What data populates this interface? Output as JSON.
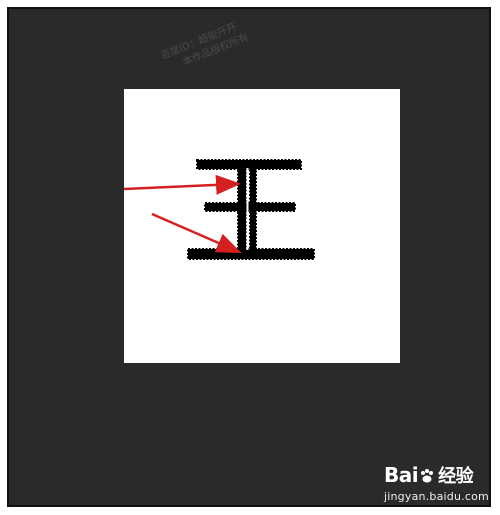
{
  "watermark": {
    "line1": "百度ID：超能开开",
    "line2": "本作品版权所有"
  },
  "canvas": {
    "glyph": "王",
    "selection": "marching-ants-outline",
    "annotations": [
      "red-arrow",
      "red-arrow"
    ]
  },
  "logo": {
    "brand": "Bai",
    "brand_suffix": "经验",
    "paw_icon": "baidu-paw-icon",
    "url": "jingyan.baidu.com"
  },
  "colors": {
    "frame": "#2a2a2a",
    "canvas": "#ffffff",
    "glyph": "#000000",
    "arrow": "#d42020"
  }
}
